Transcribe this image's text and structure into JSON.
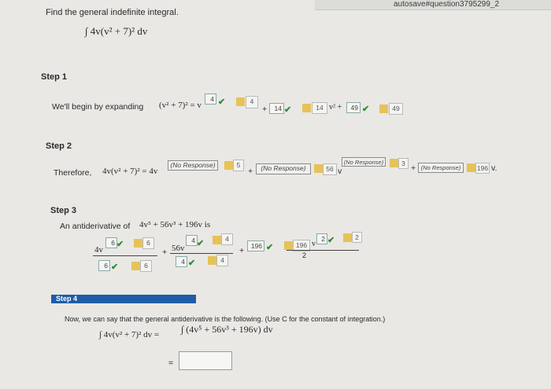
{
  "url_fragment": "autosave#question3795299_2",
  "question": {
    "prompt": "Find the general indefinite integral.",
    "integral": "∫ 4v(v² + 7)² dv"
  },
  "step1": {
    "label": "Step 1",
    "text": "We'll begin by expanding",
    "expr": "(v² + 7)² = v",
    "a1": "4",
    "a2": "4",
    "plus1": "+",
    "a3": "14",
    "a4": "14",
    "v2plus": "v² +",
    "a5": "49",
    "a6": "49"
  },
  "step2": {
    "label": "Step 2",
    "text": "Therefore,",
    "expr": "4v(v² + 7)² = 4v",
    "nr1": "(No Response)",
    "p1": "5",
    "plus": "+",
    "nr2": "(No Response)",
    "p2": "56",
    "v": "v",
    "nr3": "(No Response)",
    "p3": "3",
    "nr4": "(No Response)",
    "p4": "196",
    "tail": "v."
  },
  "step3": {
    "label": "Step 3",
    "text": "An antiderivative of",
    "expr": "4v⁵ + 56v³ + 196v is",
    "t1_coef": "4v",
    "t1_exp": "6",
    "t1_exp_b": "6",
    "t1_den": "6",
    "t1_den_b": "6",
    "plus_a": "+",
    "t2_coef": "56v",
    "t2_exp": "4",
    "t2_exp_b": "4",
    "t2_den": "4",
    "t2_den_b": "4",
    "plus_b": "+",
    "t3_a": "196",
    "t3_b": "196",
    "t3_v": "v",
    "t3_exp": "2",
    "t3_den": "2"
  },
  "step4": {
    "label": "Step 4",
    "text": "Now, we can say that the general antiderivative is the following. (Use C for the constant of integration.)",
    "lhs": "∫ 4v(v² + 7)² dv =",
    "rhs": "∫ (4v⁵ + 56v³ + 196v) dv",
    "eq": "="
  },
  "colors": {
    "check": "#2e8b3a",
    "step_bar": "#1f5ca8",
    "pencil": "#e7c258"
  }
}
